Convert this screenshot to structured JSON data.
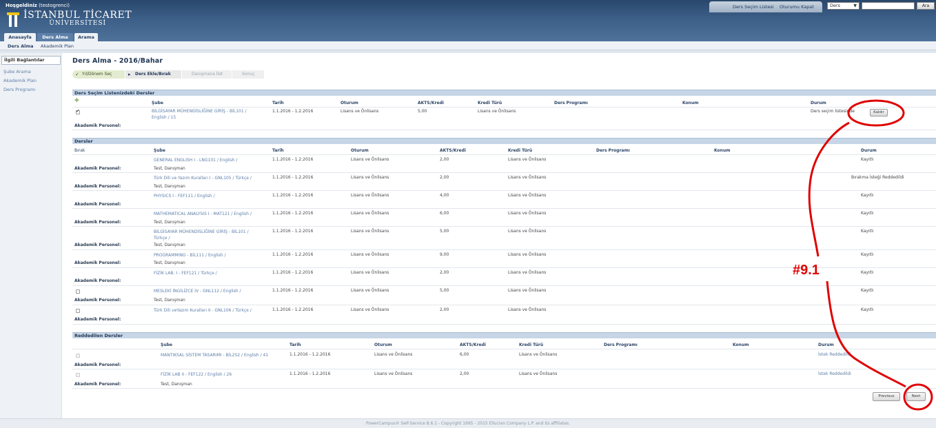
{
  "header": {
    "welcome": "Hoşgeldiniz",
    "username": "(testogrenci)",
    "logo_line1": "İSTANBUL TİCARET",
    "logo_line2": "ÜNİVERSİTESİ",
    "top_links": [
      "Ders Seçim Listesi",
      "Oturumu Kapat"
    ],
    "search_select": "Ders",
    "search_value": "",
    "search_button": "Ara",
    "main_tabs": [
      "Anasayfa",
      "Ders Alma",
      "Arama"
    ],
    "active_tab": "Ders Alma",
    "sub_nav": [
      "Ders Alma",
      "Akademik Plan"
    ],
    "brand_color": "#3c5f88"
  },
  "sidebar": {
    "header": "İlgili Bağlantılar",
    "links": [
      "Şube Arama",
      "Akademik Plan",
      "Ders Programı"
    ]
  },
  "page": {
    "title": "Ders Alma - 2016/Bahar",
    "steps": [
      "Yıl/Dönem Seç",
      "Ders Ekle/Bırak",
      "Danışmana İlet",
      "Sonuç"
    ]
  },
  "selection_list": {
    "title": "Ders Seçim Listenizdeki Dersler",
    "columns": [
      "Şube",
      "Tarih",
      "Oturum",
      "AKTS/Kredi",
      "Kredi Türü",
      "Ders Programı",
      "Konum",
      "Durum"
    ],
    "rows": [
      {
        "checked": true,
        "course_line1": "BİLGİSAYAR MÜHENDİSLİĞİNE GİRİŞ - BİL101 /",
        "course_line2": "English / 15",
        "date": "1.1.2016 - 1.2.2016",
        "session": "Lisans ve Önlisans",
        "credits": "5,00",
        "credit_type": "Lisans ve Önlisans",
        "status": "Ders seçim listesinde",
        "button": "Kaldır",
        "staff_label": "Akademik Personel:",
        "staff": ""
      }
    ]
  },
  "courses": {
    "title": "Dersler",
    "columns": [
      "Bırak",
      "Şube",
      "Tarih",
      "Oturum",
      "AKTS/Kredi",
      "Kredi Türü",
      "Ders Programı",
      "Konum",
      "Durum"
    ],
    "rows": [
      {
        "course": "GENERAL ENGLISH I - LNG101 / English /",
        "course2": "",
        "date": "1.1.2016 - 1.2.2016",
        "session": "Lisans ve Önlisans",
        "credits": "2,00",
        "credit_type": "Lisans ve Önlisans",
        "status": "Kayıtlı",
        "staff_label": "Akademik Personel:",
        "staff": "Test, Danışman",
        "checkbox": false
      },
      {
        "course": "Türk Dili ve Yazım Kuralları I - GNL105 / Türkçe /",
        "course2": "",
        "date": "1.1.2016 - 1.2.2016",
        "session": "Lisans ve Önlisans",
        "credits": "2,00",
        "credit_type": "Lisans ve Önlisans",
        "status": "Bırakma İsteği Reddedildi",
        "staff_label": "Akademik Personel:",
        "staff": "Test, Danışman",
        "checkbox": false
      },
      {
        "course": "PHYSICS I - FEF111 / English /",
        "course2": "",
        "date": "1.1.2016 - 1.2.2016",
        "session": "Lisans ve Önlisans",
        "credits": "4,00",
        "credit_type": "Lisans ve Önlisans",
        "status": "Kayıtlı",
        "staff_label": "Akademik Personel:",
        "staff": "",
        "checkbox": false
      },
      {
        "course": "MATHEMATICAL ANALYSIS I - MAT121 / English /",
        "course2": "",
        "date": "1.1.2016 - 1.2.2016",
        "session": "Lisans ve Önlisans",
        "credits": "6,00",
        "credit_type": "Lisans ve Önlisans",
        "status": "Kayıtlı",
        "staff_label": "Akademik Personel:",
        "staff": "Test, Danışman",
        "checkbox": false
      },
      {
        "course": "BİLGİSAYAR MÜHENDİSLİĞİNE GİRİŞ - BİL101 /",
        "course2": "Türkçe /",
        "date": "1.1.2016 - 1.2.2016",
        "session": "Lisans ve Önlisans",
        "credits": "5,00",
        "credit_type": "Lisans ve Önlisans",
        "status": "Kayıtlı",
        "staff_label": "Akademik Personel:",
        "staff": "Test, Danışman",
        "checkbox": false
      },
      {
        "course": "PROGRAMMING - BİL111 / English /",
        "course2": "",
        "date": "1.1.2016 - 1.2.2016",
        "session": "Lisans ve Önlisans",
        "credits": "9,00",
        "credit_type": "Lisans ve Önlisans",
        "status": "Kayıtlı",
        "staff_label": "Akademik Personel:",
        "staff": "Test, Danışman",
        "checkbox": false
      },
      {
        "course": "FİZİK LAB. I - FEF121 / Türkçe /",
        "course2": "",
        "date": "1.1.2016 - 1.2.2016",
        "session": "Lisans ve Önlisans",
        "credits": "2,00",
        "credit_type": "Lisans ve Önlisans",
        "status": "Kayıtlı",
        "staff_label": "Akademik Personel:",
        "staff": "",
        "checkbox": false
      },
      {
        "course": "MESLEKİ İNGİLİZCE IV - GNL112 / English /",
        "course2": "",
        "date": "1.1.2016 - 1.2.2016",
        "session": "Lisans ve Önlisans",
        "credits": "5,00",
        "credit_type": "Lisans ve Önlisans",
        "status": "Kayıtlı",
        "staff_label": "Akademik Personel:",
        "staff": "Test, Danışman",
        "checkbox": true
      },
      {
        "course": "Türk Dili veYazım Kuralları II - GNL106 / Türkçe /",
        "course2": "",
        "date": "1.1.2016 - 1.2.2016",
        "session": "Lisans ve Önlisans",
        "credits": "2,00",
        "credit_type": "Lisans ve Önlisans",
        "status": "Kayıtlı",
        "staff_label": "Akademik Personel:",
        "staff": "",
        "checkbox": true
      }
    ]
  },
  "rejected": {
    "title": "Reddedilen Dersler",
    "columns": [
      "Şube",
      "Tarih",
      "Oturum",
      "AKTS/Kredi",
      "Kredi Türü",
      "Ders Programı",
      "Konum",
      "Durum"
    ],
    "rows": [
      {
        "course": "MANTIKSAL SİSTEM TASARIMI - BİL252 / English / 41",
        "date": "1.1.2016 - 1.2.2016",
        "session": "Lisans ve Önlisans",
        "credits": "6,00",
        "credit_type": "Lisans ve Önlisans",
        "status": "İstek Reddedildi",
        "staff_label": "Akademik Personel:",
        "staff": ""
      },
      {
        "course": "FİZİK LAB II - FEF122 / English / 26",
        "date": "1.1.2016 - 1.2.2016",
        "session": "Lisans ve Önlisans",
        "credits": "2,00",
        "credit_type": "Lisans ve Önlisans",
        "status": "İstek Reddedildi",
        "staff_label": "Akademik Personel:",
        "staff": "Test, Danışman"
      }
    ]
  },
  "buttons": {
    "previous": "Previous",
    "next": "Next"
  },
  "footer": "PowerCampus® Self-Service 8.6.1 - Copyright 1995 - 2015 Ellucian Company L.P. and its affiliates.",
  "annotation": {
    "label": "#9.1",
    "color": "#e00000"
  }
}
